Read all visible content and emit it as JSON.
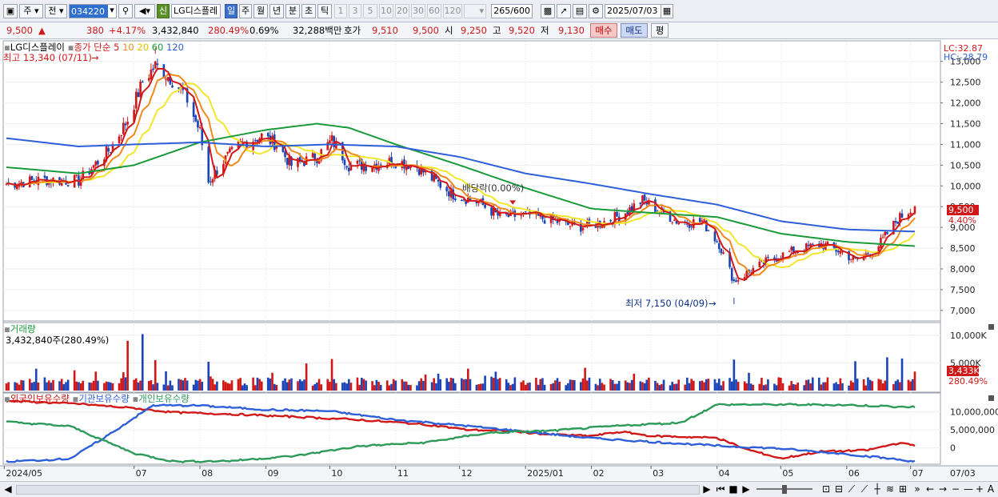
{
  "toolbar": {
    "market_select": "주",
    "prev_label": "전",
    "code_value": "034220",
    "new_badge": "신",
    "stock_name": "LG디스플레",
    "period_tabs": [
      "일",
      "주",
      "월",
      "년",
      "분",
      "초",
      "틱"
    ],
    "active_period": "일",
    "interval_buttons": [
      "1",
      "3",
      "5",
      "10",
      "20",
      "30",
      "60",
      "120"
    ],
    "bar_count": "265",
    "bar_total": "/600",
    "date_value": "2025/07/03"
  },
  "quote": {
    "price": "9,500",
    "change_arrow": "▲",
    "change": "380",
    "change_pct": "+4.17%",
    "volume": "3,432,840",
    "volume_ratio": "280.49%",
    "turnover": "0.69%",
    "amount": "32,288백만",
    "bid_label": "호가",
    "bid": "9,510",
    "ask": "9,500",
    "open_label": "시",
    "open": "9,250",
    "high_label": "고",
    "high": "9,520",
    "low_label": "저",
    "low": "9,130",
    "buy_button": "매수",
    "sell_button": "매도",
    "eval_button": "평"
  },
  "price_panel": {
    "title": "LG디스플레이",
    "indicator_label": "종가 단순",
    "ma_periods": [
      "5",
      "10",
      "20",
      "60",
      "120"
    ],
    "high_annotation": "최고 13,340 (07/11)",
    "low_annotation": "최저 7,150 (04/09)",
    "dividend_annotation": "배당락(0.00%)",
    "lc_label": "LC:32.87",
    "hc_label": "HC:-28.79",
    "last_price_tag": "9,500",
    "last_pct_tag": "4.40%"
  },
  "volume_panel": {
    "title": "거래량",
    "value_label": "3,432,840주(280.49%)",
    "last_tag": "3,433K",
    "last_pct_tag": "280.49%"
  },
  "holdings_panel": {
    "series_labels": [
      "외국인보유수량",
      "기관보유수량",
      "개인보유수량"
    ]
  },
  "x_axis_labels": [
    "2024/05",
    "07",
    "08",
    "09",
    "10",
    "11",
    "12",
    "2025/01",
    "02",
    "03",
    "04",
    "05",
    "06",
    "07",
    "07/03"
  ],
  "colors": {
    "up": "#d01818",
    "down": "#1a44b8",
    "ma5": "#d01818",
    "ma10": "#f08a1c",
    "ma20": "#f2e62a",
    "ma60": "#1a9a3a",
    "ma120": "#2e5fd8",
    "foreign": "#d01818",
    "institution": "#2e5fd8",
    "individual": "#2e9a5a",
    "accent": "#3c6fcc"
  },
  "chart_data": [
    {
      "type": "candlestick",
      "title": "LG디스플레이",
      "ylim": [
        6900,
        13400
      ],
      "y_ticks": [
        "13,000",
        "12,500",
        "12,000",
        "11,500",
        "11,000",
        "10,500",
        "10,000",
        "9,500",
        "9,000",
        "8,500",
        "8,000",
        "7,500",
        "7,000"
      ],
      "x_months": [
        "2024/05",
        "07",
        "08",
        "09",
        "10",
        "11",
        "12",
        "2025/01",
        "02",
        "03",
        "04",
        "05",
        "06",
        "07"
      ],
      "close_path": [
        [
          "2024/05/02",
          10050
        ],
        [
          "2024/05/20",
          10150
        ],
        [
          "2024/06/05",
          10120
        ],
        [
          "2024/06/20",
          10900
        ],
        [
          "2024/06/28",
          11600
        ],
        [
          "2024/07/05",
          12500
        ],
        [
          "2024/07/11",
          12900
        ],
        [
          "2024/07/18",
          12600
        ],
        [
          "2024/07/25",
          12200
        ],
        [
          "2024/08/01",
          11300
        ],
        [
          "2024/08/05",
          10100
        ],
        [
          "2024/08/12",
          10600
        ],
        [
          "2024/08/20",
          11000
        ],
        [
          "2024/08/30",
          11200
        ],
        [
          "2024/09/06",
          11000
        ],
        [
          "2024/09/13",
          10500
        ],
        [
          "2024/09/25",
          10700
        ],
        [
          "2024/10/02",
          11100
        ],
        [
          "2024/10/10",
          10500
        ],
        [
          "2024/10/20",
          10500
        ],
        [
          "2024/10/31",
          10600
        ],
        [
          "2024/11/10",
          10500
        ],
        [
          "2024/11/20",
          10100
        ],
        [
          "2024/11/28",
          9800
        ],
        [
          "2024/12/10",
          9600
        ],
        [
          "2024/12/20",
          9250
        ],
        [
          "2025/01/02",
          9300
        ],
        [
          "2025/01/15",
          9150
        ],
        [
          "2025/01/25",
          9000
        ],
        [
          "2025/02/05",
          9100
        ],
        [
          "2025/02/15",
          9300
        ],
        [
          "2025/02/25",
          9650
        ],
        [
          "2025/03/05",
          9400
        ],
        [
          "2025/03/15",
          9100
        ],
        [
          "2025/03/25",
          9150
        ],
        [
          "2025/04/02",
          8600
        ],
        [
          "2025/04/09",
          7700
        ],
        [
          "2025/04/15",
          7900
        ],
        [
          "2025/04/25",
          8200
        ],
        [
          "2025/05/05",
          8400
        ],
        [
          "2025/05/20",
          8600
        ],
        [
          "2025/05/30",
          8400
        ],
        [
          "2025/06/05",
          8200
        ],
        [
          "2025/06/15",
          8500
        ],
        [
          "2025/06/25",
          9200
        ],
        [
          "2025/07/03",
          9500
        ]
      ],
      "ma60": [
        [
          "2024/05/02",
          10450
        ],
        [
          "2024/06/05",
          10300
        ],
        [
          "2024/07/01",
          10500
        ],
        [
          "2024/08/01",
          11050
        ],
        [
          "2024/09/01",
          11350
        ],
        [
          "2024/09/25",
          11500
        ],
        [
          "2024/10/10",
          11400
        ],
        [
          "2024/11/01",
          11000
        ],
        [
          "2024/12/01",
          10500
        ],
        [
          "2025/01/01",
          9950
        ],
        [
          "2025/02/01",
          9450
        ],
        [
          "2025/03/01",
          9350
        ],
        [
          "2025/04/01",
          9250
        ],
        [
          "2025/05/01",
          8850
        ],
        [
          "2025/06/01",
          8650
        ],
        [
          "2025/07/03",
          8550
        ]
      ],
      "ma120": [
        [
          "2024/05/02",
          11150
        ],
        [
          "2024/06/05",
          10950
        ],
        [
          "2024/07/01",
          11000
        ],
        [
          "2024/08/01",
          11050
        ],
        [
          "2024/09/01",
          10950
        ],
        [
          "2024/10/01",
          11000
        ],
        [
          "2024/11/01",
          10950
        ],
        [
          "2024/12/01",
          10700
        ],
        [
          "2025/01/01",
          10300
        ],
        [
          "2025/02/01",
          10050
        ],
        [
          "2025/03/01",
          9800
        ],
        [
          "2025/04/01",
          9550
        ],
        [
          "2025/05/01",
          9150
        ],
        [
          "2025/06/01",
          8950
        ],
        [
          "2025/07/03",
          8900
        ]
      ],
      "high_point": [
        "2024/07/11",
        13340
      ],
      "low_point": [
        "2025/04/09",
        7150
      ],
      "last_close": 9500
    },
    {
      "type": "bar",
      "title": "거래량",
      "ylim": [
        0,
        12000000
      ],
      "y_ticks": [
        "10,000K",
        "5,000K"
      ],
      "last_value": 3432840,
      "spikes": [
        [
          "2024/06/28",
          9000000
        ],
        [
          "2024/07/05",
          10200000
        ],
        [
          "2024/07/11",
          5500000
        ],
        [
          "2024/08/05",
          5200000
        ],
        [
          "2024/09/20",
          4900000
        ],
        [
          "2024/10/02",
          5700000
        ],
        [
          "2025/04/09",
          5600000
        ],
        [
          "2025/06/05",
          5300000
        ],
        [
          "2025/06/20",
          6000000
        ],
        [
          "2025/06/27",
          5800000
        ],
        [
          "2025/07/03",
          3432840
        ]
      ]
    },
    {
      "type": "line",
      "title": "보유수량",
      "ylim": [
        -4500000,
        15000000
      ],
      "y_ticks": [
        "10,000,000",
        "5,000,000",
        "0"
      ],
      "series": [
        {
          "name": "외국인보유수량",
          "points": [
            [
              "2024/05/02",
              13000000
            ],
            [
              "2024/06/05",
              12200000
            ],
            [
              "2024/07/01",
              11000000
            ],
            [
              "2024/07/20",
              9800000
            ],
            [
              "2024/08/15",
              9400000
            ],
            [
              "2024/09/15",
              8600000
            ],
            [
              "2024/10/15",
              7800000
            ],
            [
              "2024/11/15",
              6500000
            ],
            [
              "2024/12/05",
              5000000
            ],
            [
              "2024/12/25",
              4700000
            ],
            [
              "2025/01/10",
              3800000
            ],
            [
              "2025/02/01",
              3300000
            ],
            [
              "2025/02/15",
              4500000
            ],
            [
              "2025/03/01",
              3300000
            ],
            [
              "2025/03/20",
              3000000
            ],
            [
              "2025/04/01",
              2800000
            ],
            [
              "2025/04/15",
              -400000
            ],
            [
              "2025/05/01",
              -2900000
            ],
            [
              "2025/05/20",
              -1000000
            ],
            [
              "2025/06/10",
              -700000
            ],
            [
              "2025/06/25",
              1300000
            ],
            [
              "2025/07/03",
              800000
            ]
          ]
        },
        {
          "name": "기관보유수량",
          "points": [
            [
              "2024/05/02",
              -3800000
            ],
            [
              "2024/06/01",
              -3000000
            ],
            [
              "2024/06/20",
              4000000
            ],
            [
              "2024/07/10",
              11800000
            ],
            [
              "2024/08/01",
              11700000
            ],
            [
              "2024/09/01",
              10600000
            ],
            [
              "2024/10/01",
              10200000
            ],
            [
              "2024/11/01",
              7800000
            ],
            [
              "2024/12/01",
              6300000
            ],
            [
              "2025/01/01",
              4500000
            ],
            [
              "2025/02/01",
              2700000
            ],
            [
              "2025/03/01",
              1700000
            ],
            [
              "2025/04/01",
              600000
            ],
            [
              "2025/05/01",
              -200000
            ],
            [
              "2025/06/01",
              -1700000
            ],
            [
              "2025/07/03",
              -3700000
            ]
          ]
        },
        {
          "name": "개인보유수량",
          "points": [
            [
              "2024/05/02",
              7200000
            ],
            [
              "2024/06/01",
              6000000
            ],
            [
              "2024/07/01",
              -1500000
            ],
            [
              "2024/07/20",
              -3800000
            ],
            [
              "2024/08/15",
              -3600000
            ],
            [
              "2024/09/15",
              -2200000
            ],
            [
              "2024/10/15",
              500000
            ],
            [
              "2024/11/15",
              1500000
            ],
            [
              "2024/12/15",
              4200000
            ],
            [
              "2025/01/15",
              4800000
            ],
            [
              "2025/02/15",
              6200000
            ],
            [
              "2025/03/15",
              7000000
            ],
            [
              "2025/04/01",
              12000000
            ],
            [
              "2025/05/01",
              12000000
            ],
            [
              "2025/06/01",
              11900000
            ],
            [
              "2025/07/03",
              11300000
            ]
          ]
        }
      ]
    }
  ]
}
